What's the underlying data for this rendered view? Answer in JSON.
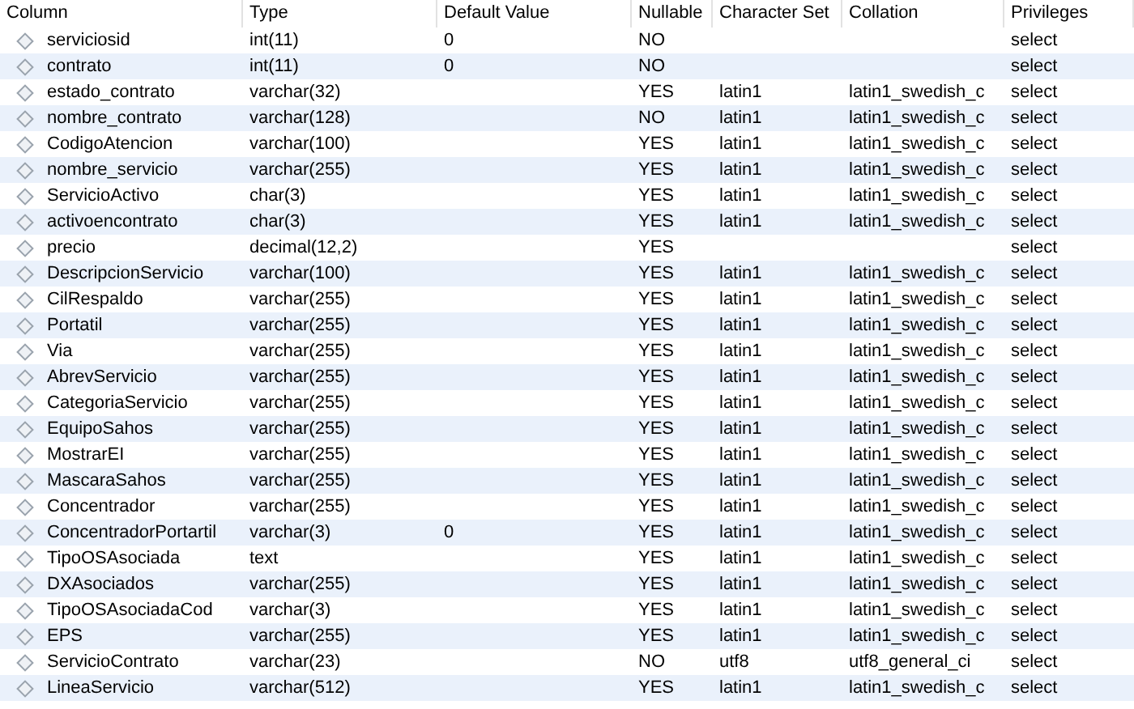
{
  "table": {
    "columns": [
      "Column",
      "Type",
      "Default Value",
      "Nullable",
      "Character Set",
      "Collation",
      "Privileges"
    ],
    "rows": [
      {
        "column": "serviciosid",
        "type": "int(11)",
        "default": "0",
        "nullable": "NO",
        "privileges": "select"
      },
      {
        "column": "contrato",
        "type": "int(11)",
        "default": "0",
        "nullable": "NO",
        "privileges": "select"
      },
      {
        "column": "estado_contrato",
        "type": "varchar(32)",
        "nullable": "YES",
        "charset": "latin1",
        "collation": "latin1_swedish_c",
        "privileges": "select"
      },
      {
        "column": "nombre_contrato",
        "type": "varchar(128)",
        "nullable": "NO",
        "charset": "latin1",
        "collation": "latin1_swedish_c",
        "privileges": "select"
      },
      {
        "column": "CodigoAtencion",
        "type": "varchar(100)",
        "nullable": "YES",
        "charset": "latin1",
        "collation": "latin1_swedish_c",
        "privileges": "select"
      },
      {
        "column": "nombre_servicio",
        "type": "varchar(255)",
        "nullable": "YES",
        "charset": "latin1",
        "collation": "latin1_swedish_c",
        "privileges": "select"
      },
      {
        "column": "ServicioActivo",
        "type": "char(3)",
        "nullable": "YES",
        "charset": "latin1",
        "collation": "latin1_swedish_c",
        "privileges": "select"
      },
      {
        "column": "activoencontrato",
        "type": "char(3)",
        "nullable": "YES",
        "charset": "latin1",
        "collation": "latin1_swedish_c",
        "privileges": "select"
      },
      {
        "column": "precio",
        "type": "decimal(12,2)",
        "nullable": "YES",
        "privileges": "select"
      },
      {
        "column": "DescripcionServicio",
        "type": "varchar(100)",
        "nullable": "YES",
        "charset": "latin1",
        "collation": "latin1_swedish_c",
        "privileges": "select"
      },
      {
        "column": "CilRespaldo",
        "type": "varchar(255)",
        "nullable": "YES",
        "charset": "latin1",
        "collation": "latin1_swedish_c",
        "privileges": "select"
      },
      {
        "column": "Portatil",
        "type": "varchar(255)",
        "nullable": "YES",
        "charset": "latin1",
        "collation": "latin1_swedish_c",
        "privileges": "select"
      },
      {
        "column": "Via",
        "type": "varchar(255)",
        "nullable": "YES",
        "charset": "latin1",
        "collation": "latin1_swedish_c",
        "privileges": "select"
      },
      {
        "column": "AbrevServicio",
        "type": "varchar(255)",
        "nullable": "YES",
        "charset": "latin1",
        "collation": "latin1_swedish_c",
        "privileges": "select"
      },
      {
        "column": "CategoriaServicio",
        "type": "varchar(255)",
        "nullable": "YES",
        "charset": "latin1",
        "collation": "latin1_swedish_c",
        "privileges": "select"
      },
      {
        "column": "EquipoSahos",
        "type": "varchar(255)",
        "nullable": "YES",
        "charset": "latin1",
        "collation": "latin1_swedish_c",
        "privileges": "select"
      },
      {
        "column": "MostrarEI",
        "type": "varchar(255)",
        "nullable": "YES",
        "charset": "latin1",
        "collation": "latin1_swedish_c",
        "privileges": "select"
      },
      {
        "column": "MascaraSahos",
        "type": "varchar(255)",
        "nullable": "YES",
        "charset": "latin1",
        "collation": "latin1_swedish_c",
        "privileges": "select"
      },
      {
        "column": "Concentrador",
        "type": "varchar(255)",
        "nullable": "YES",
        "charset": "latin1",
        "collation": "latin1_swedish_c",
        "privileges": "select"
      },
      {
        "column": "ConcentradorPortartil",
        "type": "varchar(3)",
        "default": "0",
        "nullable": "YES",
        "charset": "latin1",
        "collation": "latin1_swedish_c",
        "privileges": "select"
      },
      {
        "column": "TipoOSAsociada",
        "type": "text",
        "nullable": "YES",
        "charset": "latin1",
        "collation": "latin1_swedish_c",
        "privileges": "select"
      },
      {
        "column": "DXAsociados",
        "type": "varchar(255)",
        "nullable": "YES",
        "charset": "latin1",
        "collation": "latin1_swedish_c",
        "privileges": "select"
      },
      {
        "column": "TipoOSAsociadaCod",
        "type": "varchar(3)",
        "nullable": "YES",
        "charset": "latin1",
        "collation": "latin1_swedish_c",
        "privileges": "select"
      },
      {
        "column": "EPS",
        "type": "varchar(255)",
        "nullable": "YES",
        "charset": "latin1",
        "collation": "latin1_swedish_c",
        "privileges": "select"
      },
      {
        "column": "ServicioContrato",
        "type": "varchar(23)",
        "nullable": "NO",
        "charset": "utf8",
        "collation": "utf8_general_ci",
        "privileges": "select"
      },
      {
        "column": "LineaServicio",
        "type": "varchar(512)",
        "nullable": "YES",
        "charset": "latin1",
        "collation": "latin1_swedish_c",
        "privileges": "select"
      }
    ]
  }
}
